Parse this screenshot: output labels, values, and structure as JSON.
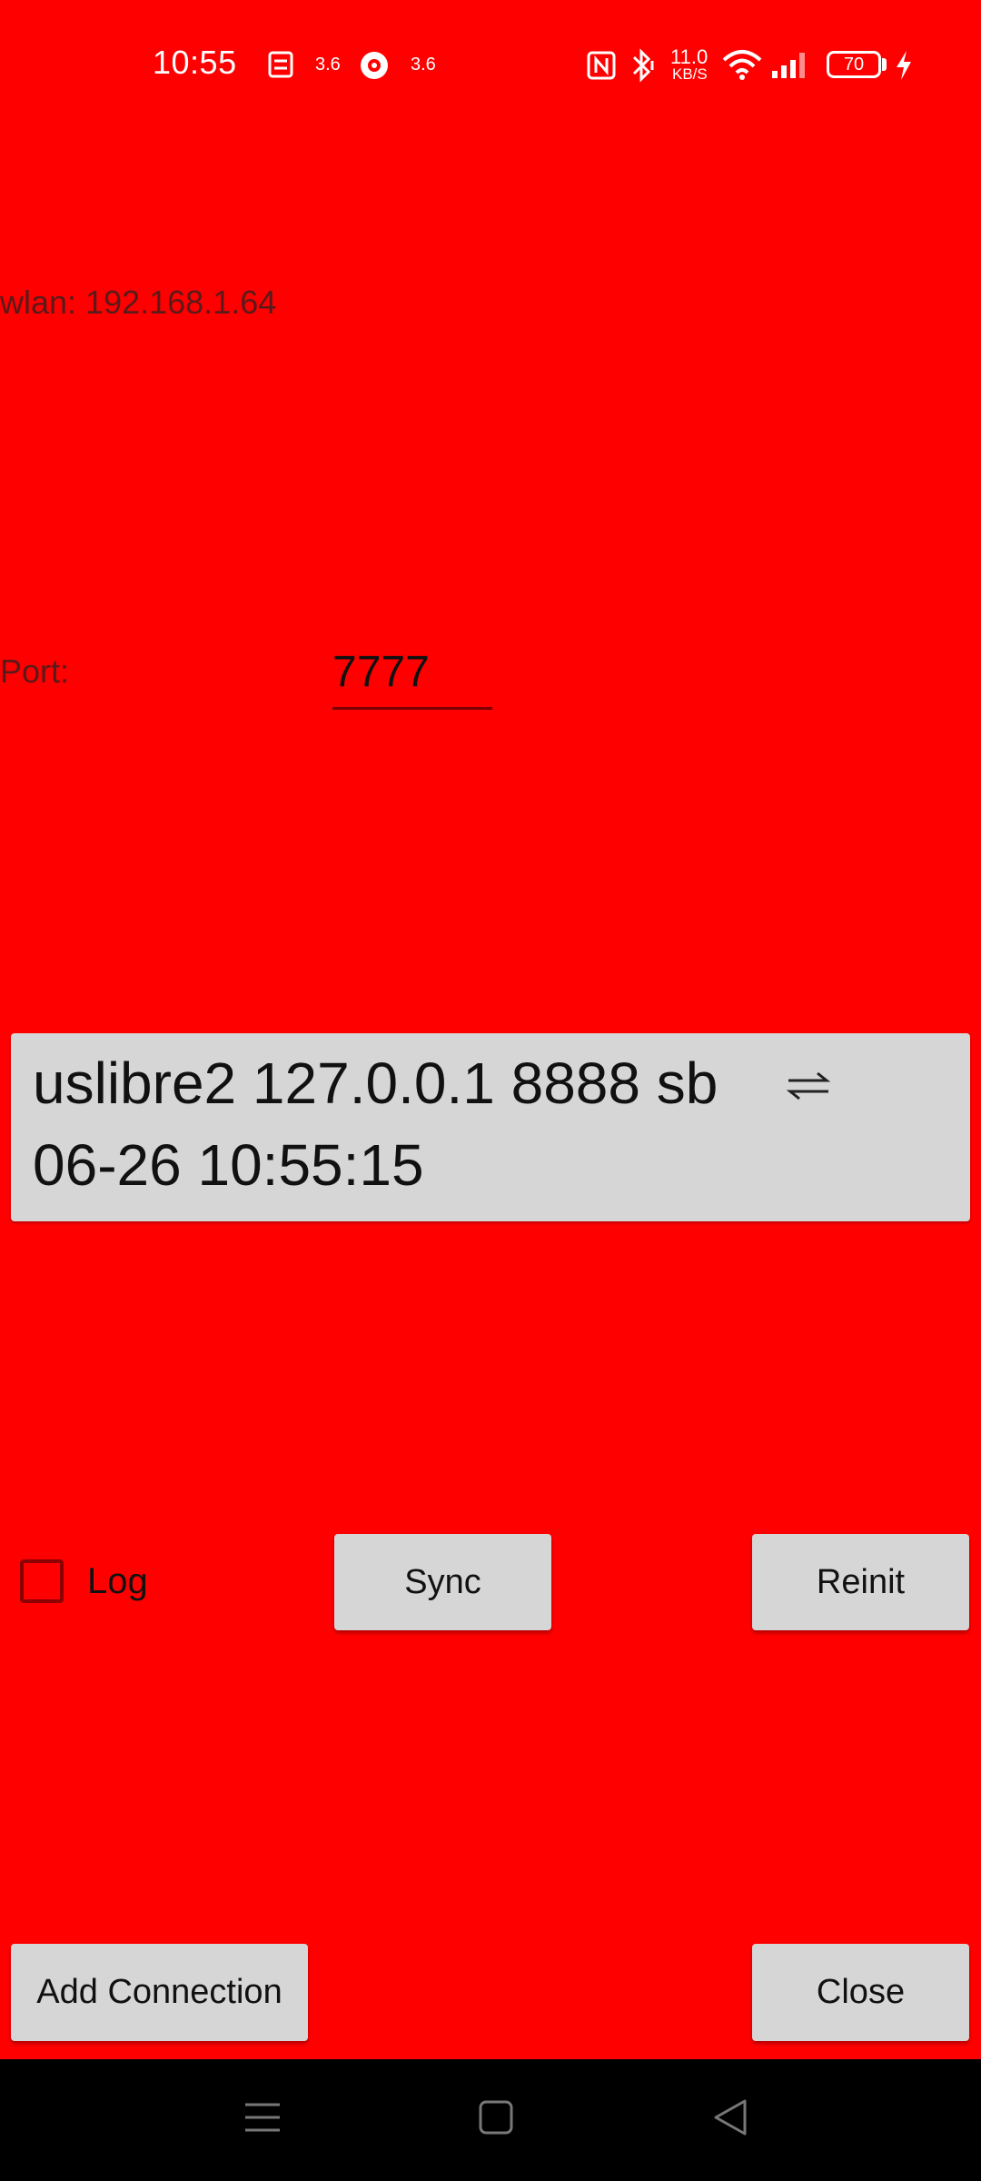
{
  "status_bar": {
    "time": "10:55",
    "data_speed_1": "3.6",
    "data_speed_2": "3.6",
    "net_speed_value": "11.0",
    "net_speed_unit": "KB/S",
    "battery_level": "70",
    "icons": [
      "sim-card-icon",
      "hotspot-icon",
      "nfc-icon",
      "bluetooth-icon",
      "wifi-icon",
      "signal-icon",
      "battery-icon",
      "charging-icon"
    ]
  },
  "network": {
    "wlan_text": "wlan: 192.168.1.64"
  },
  "port": {
    "label": "Port:",
    "value": "7777"
  },
  "connection": {
    "line1": "uslibre2 127.0.0.1 8888 sb",
    "line2": "06-26 10:55:15",
    "icon": "swap-arrows-icon"
  },
  "controls": {
    "log_label": "Log",
    "log_checked": false,
    "sync_label": "Sync",
    "reinit_label": "Reinit"
  },
  "footer": {
    "add_connection_label": "Add Connection",
    "close_label": "Close"
  },
  "navigation": {
    "icons": [
      "menu-icon",
      "home-icon",
      "back-icon"
    ]
  },
  "colors": {
    "background": "#ff0000",
    "button": "#d6d6d6",
    "nav_bar": "#000000"
  }
}
